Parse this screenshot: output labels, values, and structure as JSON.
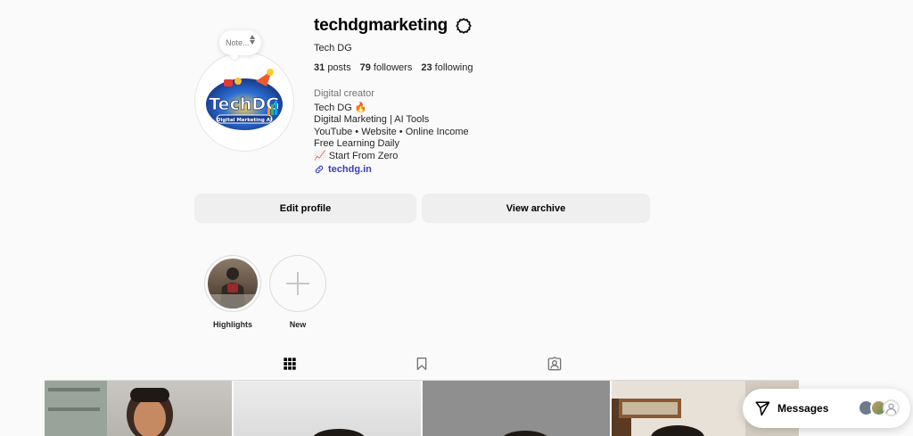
{
  "profile": {
    "username": "techdgmarketing",
    "full_name": "Tech DG",
    "note_label": "Note...",
    "avatar_text_main": "TechDG",
    "avatar_text_sub": "Digital Marketing AI",
    "stats": {
      "posts_count": "31",
      "posts_label": "posts",
      "followers_count": "79",
      "followers_label": "followers",
      "following_count": "23",
      "following_label": "following"
    },
    "category": "Digital creator",
    "bio_lines": [
      "Tech DG 🔥",
      "Digital Marketing | AI Tools",
      "YouTube • Website • Online Income",
      "Free Learning Daily",
      "📈 Start From Zero"
    ],
    "link": "techdg.in"
  },
  "actions": {
    "edit_profile": "Edit profile",
    "view_archive": "View archive"
  },
  "highlights": [
    {
      "label": "Highlights"
    },
    {
      "label": "New"
    }
  ],
  "tabs": [
    {
      "icon": "grid-icon",
      "active": true
    },
    {
      "icon": "bookmark-icon",
      "active": false
    },
    {
      "icon": "tagged-icon",
      "active": false
    }
  ],
  "messages": {
    "label": "Messages"
  },
  "colors": {
    "link": "#3c3fb8",
    "button_bg": "#efefef",
    "background": "#fafafa"
  }
}
